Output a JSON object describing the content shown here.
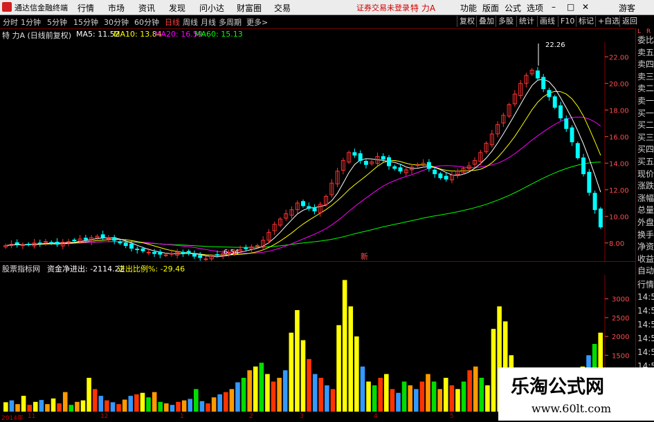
{
  "menubar": {
    "app_title": "通达信金融终端",
    "items": [
      "行情",
      "市场",
      "资讯",
      "发现",
      "问小达",
      "财富圈",
      "交易"
    ],
    "login_status": "证券交易未登录",
    "stock_title": "特 力A",
    "right_items": [
      "功能",
      "版面",
      "公式",
      "选项"
    ],
    "window_controls": [
      "–",
      "□",
      "✕"
    ],
    "user_label": "游客"
  },
  "toolbar": {
    "periods": [
      "分时",
      "1分钟",
      "5分钟",
      "15分钟",
      "30分钟",
      "60分钟",
      "日线",
      "周线",
      "月线",
      "多周期",
      "更多>"
    ],
    "active_period": "日线",
    "right_buttons": [
      "复权",
      "叠加",
      "多股",
      "统计",
      "画线",
      "F10",
      "标记",
      "+自选",
      "返回"
    ]
  },
  "main_legend": {
    "title": "特 力A (日线前复权)",
    "ma5": "MA5: 11.52",
    "ma10": "MA10: 13.84",
    "ma20": "MA20: 16.59",
    "ma60": "MA60: 15.13",
    "high_label": "22.26",
    "low_label": "6.54",
    "mid_marker": "新"
  },
  "vol_legend": {
    "title": "股票指标网",
    "field1": "资金净进出: -2114.22",
    "field2": "进出比例%: -29.46"
  },
  "price_axis": [
    "22.00",
    "20.00",
    "18.00",
    "16.00",
    "14.00",
    "12.00",
    "10.00",
    "8.00"
  ],
  "vol_axis": [
    "3000",
    "2500",
    "2000",
    "1500"
  ],
  "date_axis": [
    "2014年",
    "11",
    "12",
    "1",
    "2",
    "3",
    "4",
    "5"
  ],
  "right_panel": {
    "top_badge": [
      "L",
      "R"
    ],
    "top_labels": [
      "委比",
      "卖五",
      "卖四",
      "卖三",
      "卖二",
      "卖一",
      "买一",
      "买二",
      "买三",
      "买四",
      "买五",
      "现价",
      "涨跌",
      "涨幅",
      "总量",
      "外盘",
      "换手",
      "净资",
      "收益"
    ],
    "bottom_labels": [
      "自动",
      "行情",
      "14:5",
      "14:5",
      "14:5",
      "14:5",
      "14:5",
      "14:5",
      "14:5"
    ]
  },
  "watermark": {
    "title": "乐淘公式网",
    "url": "www.60lt.com"
  },
  "colors": {
    "up": "#ff3232",
    "down": "#00ffff",
    "ma5": "#ffffff",
    "ma10": "#ffff00",
    "ma20": "#ff00ff",
    "ma60": "#00ff00",
    "axis_red": "#ff4d4d",
    "frame": "#8a0000",
    "vol_yellow": "#ffff00",
    "vol_orange": "#ff9900",
    "vol_red": "#ff3300",
    "vol_green": "#00dd00",
    "vol_blue": "#3399ff"
  },
  "chart_data": {
    "type": "candlestick",
    "price_ylim": [
      7,
      23
    ],
    "closes": [
      7.8,
      7.9,
      7.9,
      7.85,
      7.9,
      8.0,
      7.95,
      8.1,
      8.0,
      7.9,
      8.05,
      8.1,
      8.2,
      8.3,
      8.25,
      8.4,
      8.5,
      8.4,
      8.35,
      8.2,
      8.0,
      7.8,
      7.6,
      7.5,
      7.4,
      7.3,
      7.2,
      7.15,
      7.1,
      7.2,
      7.3,
      7.25,
      7.2,
      7.0,
      6.9,
      6.8,
      7.0,
      7.1,
      7.2,
      7.3,
      7.4,
      7.5,
      7.6,
      7.7,
      7.8,
      8.2,
      8.8,
      9.4,
      9.8,
      10.2,
      10.5,
      11.0,
      10.8,
      10.6,
      10.4,
      10.9,
      11.5,
      12.5,
      13.4,
      14.2,
      14.8,
      14.6,
      14.2,
      13.9,
      14.1,
      14.5,
      14.3,
      13.8,
      13.6,
      13.4,
      13.5,
      13.7,
      13.9,
      14.0,
      13.6,
      13.2,
      12.9,
      12.8,
      13.1,
      13.4,
      13.6,
      13.8,
      14.2,
      14.8,
      15.5,
      16.2,
      16.9,
      17.6,
      18.4,
      19.2,
      20.0,
      20.6,
      21.0,
      20.4,
      19.6,
      19.0,
      18.2,
      17.4,
      16.6,
      15.6,
      14.4,
      13.2,
      11.8,
      10.5,
      9.2
    ],
    "volume_ylim": [
      0,
      3600
    ],
    "volumes": [
      250,
      300,
      200,
      420,
      180,
      260,
      310,
      200,
      350,
      220,
      520,
      180,
      260,
      300,
      900,
      600,
      420,
      300,
      250,
      200,
      320,
      420,
      460,
      500,
      380,
      520,
      260,
      220,
      180,
      260,
      300,
      340,
      600,
      280,
      220,
      380,
      460,
      520,
      600,
      780,
      900,
      1100,
      1200,
      1300,
      1000,
      800,
      900,
      1100,
      2100,
      2700,
      1900,
      1400,
      1000,
      900,
      700,
      600,
      2300,
      3500,
      2800,
      2000,
      1200,
      800,
      700,
      900,
      1000,
      600,
      500,
      800,
      700,
      600,
      800,
      1000,
      800,
      600,
      900,
      700,
      600,
      800,
      1100,
      1200,
      900,
      700,
      2200,
      2800,
      2400,
      1500,
      1100,
      900,
      800,
      700,
      600,
      500,
      600,
      700,
      800,
      900,
      1000,
      1200,
      1500,
      1800,
      2100
    ]
  }
}
